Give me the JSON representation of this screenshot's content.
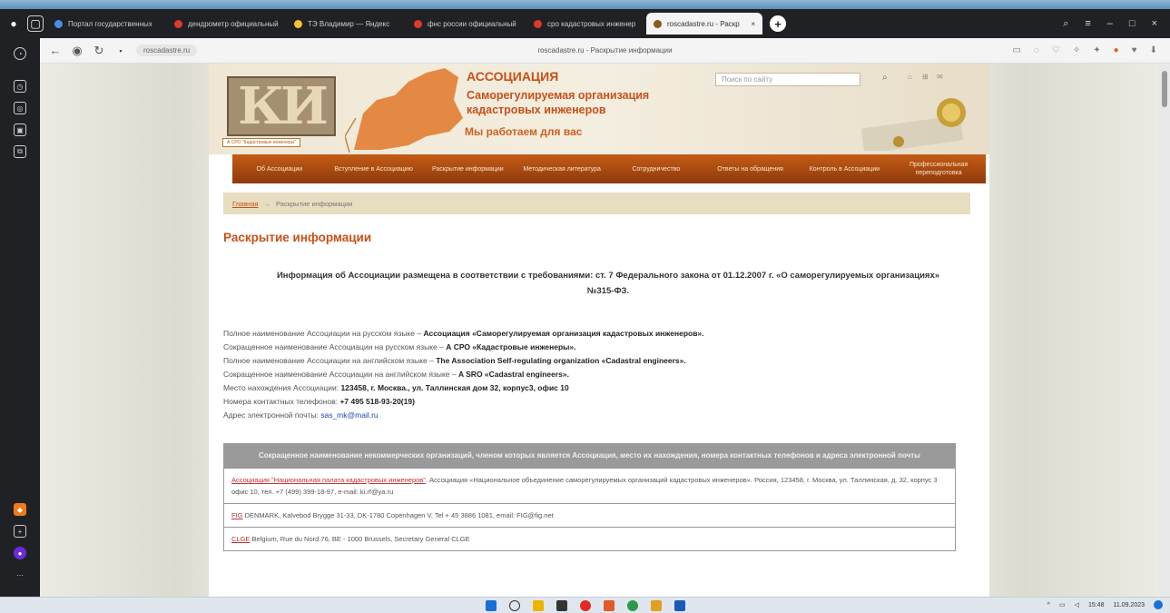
{
  "browser": {
    "tabs": [
      {
        "label": "Портал государственных",
        "color": "#4a90e2"
      },
      {
        "label": "дендрометр официальный",
        "color": "#e03a2a"
      },
      {
        "label": "ТЭ Владимир — Яндекс",
        "color": "#f4c430"
      },
      {
        "label": "фнс россии официальный",
        "color": "#e03a2a"
      },
      {
        "label": "сро кадастровых инженер",
        "color": "#e03a2a"
      },
      {
        "label": "roscadastre.ru - Раскр",
        "color": "#8a5a20"
      }
    ],
    "active_tab": 5,
    "site_chip": "roscadastre.ru",
    "page_title": "roscadastre.ru - Раскрытие информации"
  },
  "header": {
    "logo_text": "КИ",
    "logo_caption": "А СРО \"Кадастровые инженеры\"",
    "title": "АССОЦИАЦИЯ",
    "subtitle_line1": "Саморегулируемая организация",
    "subtitle_line2": "кадастровых инженеров",
    "slogan": "Мы работаем для вас",
    "search_placeholder": "Поиск по сайту"
  },
  "menu": [
    "Об Ассоциации",
    "Вступление в Ассоциацию",
    "Раскрытие информации",
    "Методическая литература",
    "Сотрудничество",
    "Ответы на обращения",
    "Контроль в Ассоциации",
    "Профессиональная переподготовка"
  ],
  "breadcrumb": {
    "home": "Главная",
    "separator": "→",
    "current": "Раскрытие информации"
  },
  "content": {
    "heading": "Раскрытие информации",
    "intro": "Информация об Ассоциации размещена в соответствии с требованиями: ст. 7 Федерального закона от 01.12.2007 г. «О саморегулируемых организациях» №315-ФЗ.",
    "fields": [
      {
        "label": "Полное наименование Ассоциации на русском языке – ",
        "value": "Ассоциация «Саморегулируемая организация кадастровых инженеров»."
      },
      {
        "label": "Сокращенное наименование Ассоциации на русском языке – ",
        "value": "А СРО «Кадастровые инженеры»."
      },
      {
        "label": "Полное наименование Ассоциации на английском языке – ",
        "value": "The Association Self-regulating organization «Cadastral engineers»."
      },
      {
        "label": "Сокращенное наименование Ассоциации на английском языке – ",
        "value": "A SRO «Cadastral engineers»."
      },
      {
        "label": "Место нахождения Ассоциации: ",
        "value": "123458, г. Москва., ул. Таллинская дом 32, корпус3, офис 10"
      },
      {
        "label": "Номера контактных телефонов: ",
        "value": "+7 495 518-93-20(19)"
      },
      {
        "label": "Адрес электронной почты: ",
        "link": "sas_mk@mail.ru"
      }
    ],
    "table": {
      "header": "Сокращенное наименование некоммерческих организаций, членом которых является Ассоциация, место их нахождения, номера контактных телефонов и адреса электронной почты",
      "rows": [
        {
          "link": "Ассоциация \"Национальная палата кадастровых инженеров\"",
          "text": ". Ассоциация «Национальное объединение саморегулируемых организаций кадастровых инженеров». Россия, 123458, г. Москва, ул. Таллинская, д. 32, корпус 3 офис 10, тел. +7 (499) 399-18-97, e-mail: ki.rf@ya.ru"
        },
        {
          "link": "FIG",
          "text": " DENMARK, Kalvebod Brygge 31-33, DK-1780 Copenhagen V, Tel + 45 3886 1081, email: FIG@fig.net"
        },
        {
          "link": "CLGE",
          "text": " Belgium, Rue du Nord 76, BE - 1000 Brussels, Secretary General CLGE"
        }
      ]
    }
  },
  "taskbar": {
    "time": "15:48",
    "date": "11.09.2023"
  }
}
